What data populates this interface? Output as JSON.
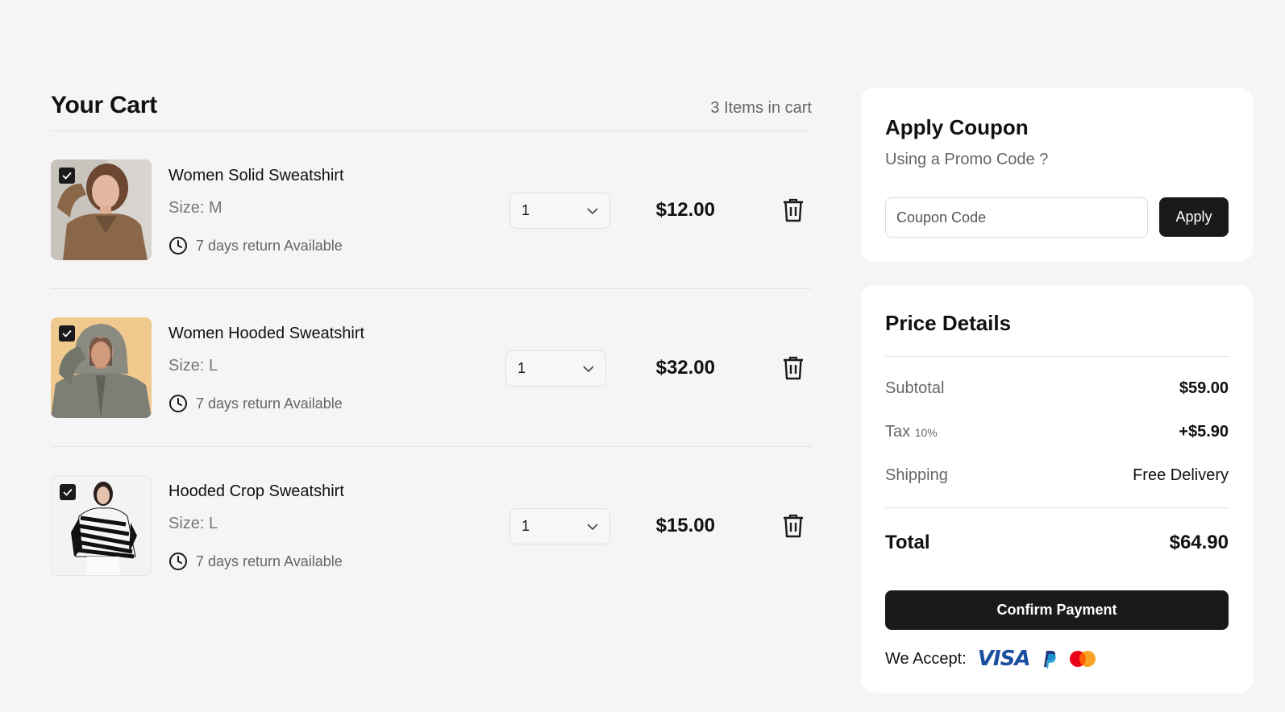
{
  "cart": {
    "title": "Your Cart",
    "count_label": "3 Items in cart",
    "items": [
      {
        "name": "Women Solid Sweatshirt",
        "size": "Size: M",
        "return": "7 days return Available",
        "quantity": "1",
        "price": "$12.00",
        "checked": true
      },
      {
        "name": "Women Hooded Sweatshirt",
        "size": "Size: L",
        "return": "7 days return Available",
        "quantity": "1",
        "price": "$32.00",
        "checked": true
      },
      {
        "name": "Hooded Crop Sweatshirt",
        "size": "Size: L",
        "return": "7 days return Available",
        "quantity": "1",
        "price": "$15.00",
        "checked": true
      }
    ]
  },
  "coupon": {
    "title": "Apply Coupon",
    "subtitle": "Using a Promo Code ?",
    "placeholder": "Coupon Code",
    "apply_label": "Apply"
  },
  "price_details": {
    "title": "Price Details",
    "subtotal_label": "Subtotal",
    "subtotal_value": "$59.00",
    "tax_label": "Tax",
    "tax_rate": "10%",
    "tax_value": "+$5.90",
    "shipping_label": "Shipping",
    "shipping_value": "Free Delivery",
    "total_label": "Total",
    "total_value": "$64.90",
    "confirm_label": "Confirm Payment",
    "accept_label": "We Accept:",
    "visa_label": "VISA"
  },
  "colors": {
    "accent": "#1a1a1a",
    "background": "#f5f5f5",
    "visa": "#1a4fa0",
    "paypal_dark": "#253b80",
    "paypal_light": "#179bd7",
    "mastercard_red": "#eb001b",
    "mastercard_orange": "#f79e1b"
  },
  "icons": [
    "check-icon",
    "clock-icon",
    "chevron-down-icon",
    "trash-icon",
    "paypal-icon",
    "mastercard-icon"
  ]
}
